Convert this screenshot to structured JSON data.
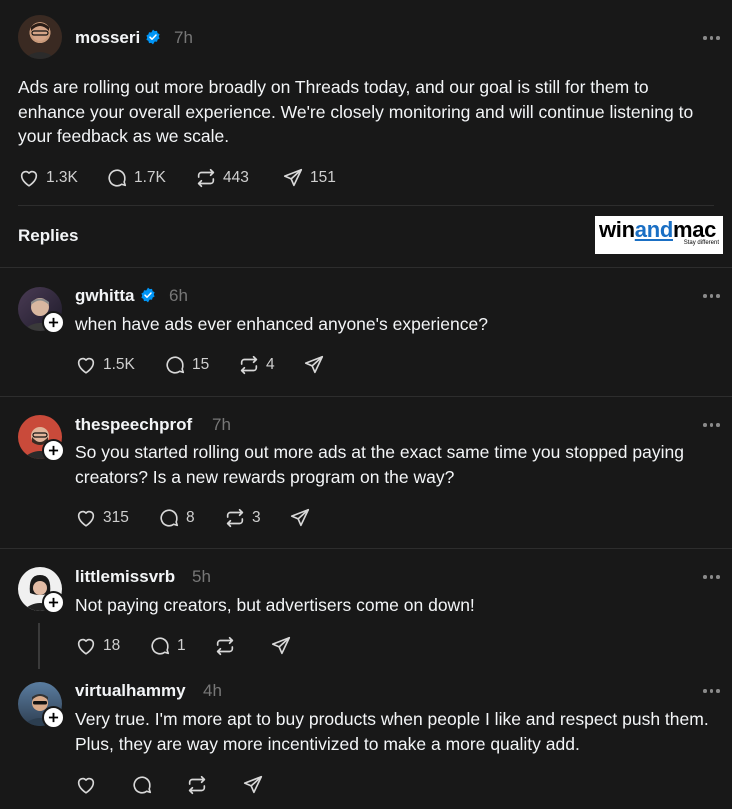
{
  "post": {
    "username": "mosseri",
    "time": "7h",
    "text": "Ads are rolling out more broadly on Threads today, and our goal is still for them to enhance your overall experience. We're closely monitoring and will continue listening to your feedback as we scale.",
    "likes": "1.3K",
    "replies": "1.7K",
    "reposts": "443",
    "shares": "151"
  },
  "replies_header": "Replies",
  "watermark": {
    "part1": "win",
    "part2": "and",
    "part3": "mac",
    "tagline": "Stay different"
  },
  "replies": [
    {
      "username": "gwhitta",
      "verified": true,
      "time": "6h",
      "text": "when have ads ever enhanced anyone's experience?",
      "likes": "1.5K",
      "replies": "15",
      "reposts": "4"
    },
    {
      "username": "thespeechprof",
      "time": "7h",
      "text": "So you started rolling out more ads at the exact same time you stopped paying creators? Is a new rewards program on the way?",
      "likes": "315",
      "replies": "8",
      "reposts": "3"
    },
    {
      "username": "littlemissvrb",
      "time": "5h",
      "text": "Not paying creators, but advertisers come on down!",
      "likes": "18",
      "replies": "1"
    },
    {
      "username": "virtualhammy",
      "time": "4h",
      "text": "Very true. I'm more apt to buy products when people I like and respect push them. Plus, they are way more incentivized to make a more quality add."
    }
  ],
  "colors": {
    "background": "#181818",
    "verified": "#0095f6",
    "muted": "#777777"
  }
}
